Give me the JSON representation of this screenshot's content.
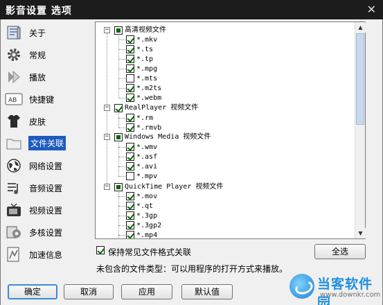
{
  "window": {
    "title": "影音设置 选项",
    "close_glyph": "✕"
  },
  "sidebar": {
    "items": [
      {
        "label": "关于",
        "icon": "book-icon"
      },
      {
        "label": "常规",
        "icon": "gear-icon"
      },
      {
        "label": "播放",
        "icon": "play-arrows-icon"
      },
      {
        "label": "快捷键",
        "icon": "keyboard-key-icon"
      },
      {
        "label": "皮肤",
        "icon": "shirt-icon"
      },
      {
        "label": "文件关联",
        "icon": "folder-icon",
        "active": true
      },
      {
        "label": "网络设置",
        "icon": "globe-icon"
      },
      {
        "label": "音频设置",
        "icon": "audio-icon"
      },
      {
        "label": "视频设置",
        "icon": "tv-icon"
      },
      {
        "label": "多核设置",
        "icon": "cpu-cores-icon"
      },
      {
        "label": "加速信息",
        "icon": "speed-info-icon"
      }
    ]
  },
  "tree": {
    "groups": [
      {
        "label": "高清视频文件",
        "state": "partial",
        "items": [
          {
            "label": "*.mkv",
            "checked": true
          },
          {
            "label": "*.ts",
            "checked": true
          },
          {
            "label": "*.tp",
            "checked": true
          },
          {
            "label": "*.mpg",
            "checked": true
          },
          {
            "label": "*.mts",
            "checked": false
          },
          {
            "label": "*.m2ts",
            "checked": true
          },
          {
            "label": "*.webm",
            "checked": true
          }
        ]
      },
      {
        "label": "RealPlayer 视频文件",
        "state": "checked",
        "items": [
          {
            "label": "*.rm",
            "checked": true
          },
          {
            "label": "*.rmvb",
            "checked": true
          }
        ]
      },
      {
        "label": "Windows Media 视频文件",
        "state": "partial",
        "items": [
          {
            "label": "*.wmv",
            "checked": true
          },
          {
            "label": "*.asf",
            "checked": true
          },
          {
            "label": "*.avi",
            "checked": true
          },
          {
            "label": "*.mpv",
            "checked": false
          }
        ]
      },
      {
        "label": "QuickTime Player 视频文件",
        "state": "partial",
        "items": [
          {
            "label": "*.mov",
            "checked": true
          },
          {
            "label": "*.qt",
            "checked": true
          },
          {
            "label": "*.3gp",
            "checked": true
          },
          {
            "label": "*.3gp2",
            "checked": true
          },
          {
            "label": "*.mp4",
            "checked": true
          }
        ]
      }
    ]
  },
  "options": {
    "keep_label": "保持常见文件格式关联",
    "keep_checked": true,
    "select_all": "全选",
    "info": "未包含的文件类型：可以用程序的打开方式来播放。"
  },
  "buttons": {
    "ok": "确定",
    "cancel": "取消",
    "apply": "应用",
    "default": "默认值"
  },
  "watermark": {
    "name": "当客软件园",
    "url": "www.downkr.com"
  }
}
